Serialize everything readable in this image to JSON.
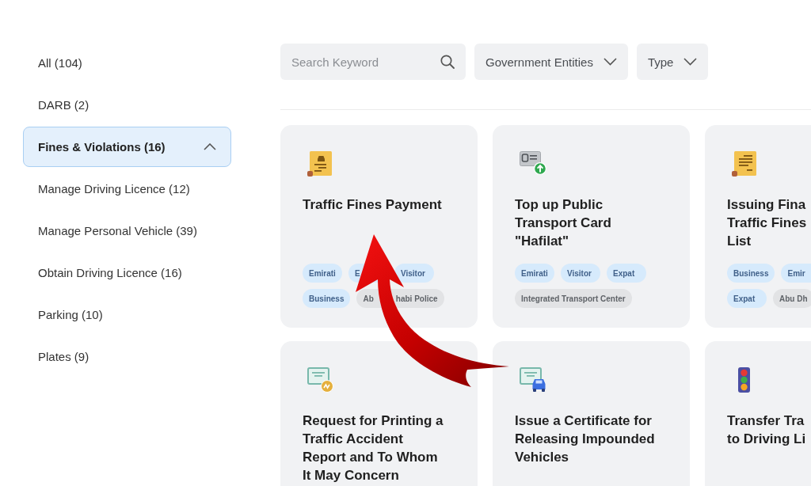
{
  "sidebar": {
    "items": [
      {
        "label": "All (104)",
        "selected": false
      },
      {
        "label": "DARB (2)",
        "selected": false
      },
      {
        "label": "Fines & Violations (16)",
        "selected": true
      },
      {
        "label": "Manage Driving Licence (12)",
        "selected": false
      },
      {
        "label": "Manage Personal Vehicle (39)",
        "selected": false
      },
      {
        "label": "Obtain Driving Licence (16)",
        "selected": false
      },
      {
        "label": "Parking (10)",
        "selected": false
      },
      {
        "label": "Plates (9)",
        "selected": false
      }
    ]
  },
  "filters": {
    "search": {
      "placeholder": "Search Keyword"
    },
    "dropdowns": [
      {
        "label": "Government Entities"
      },
      {
        "label": "Type"
      }
    ]
  },
  "cards": [
    {
      "title": "Traffic Fines Payment",
      "tags": [
        {
          "label": "Emirati",
          "kind": "audience"
        },
        {
          "label": "E",
          "kind": "audience"
        },
        {
          "label": "Visitor",
          "kind": "audience"
        },
        {
          "label": "Business",
          "kind": "audience"
        },
        {
          "label_parts": [
            "Ab",
            "habi Police"
          ],
          "kind": "entity"
        }
      ]
    },
    {
      "title": "Top up Public Transport Card \"Hafilat\"",
      "tags": [
        {
          "label": "Emirati",
          "kind": "audience"
        },
        {
          "label": "Visitor",
          "kind": "audience"
        },
        {
          "label": "Expat",
          "kind": "audience"
        },
        {
          "label": "Integrated Transport Center",
          "kind": "entity"
        }
      ]
    },
    {
      "title": "Issuing Fina Traffic Fines List",
      "tags": [
        {
          "label": "Business",
          "kind": "audience"
        },
        {
          "label": "Emir",
          "kind": "audience"
        },
        {
          "label": "Expat",
          "kind": "audience"
        },
        {
          "label": "Abu Dh",
          "kind": "entity"
        }
      ]
    },
    {
      "title": "Request for Printing a Traffic Accident Report and To Whom It May Concern"
    },
    {
      "title": "Issue a Certificate for Releasing Impounded Vehicles"
    },
    {
      "title": "Transfer Tra to Driving Li"
    }
  ]
}
